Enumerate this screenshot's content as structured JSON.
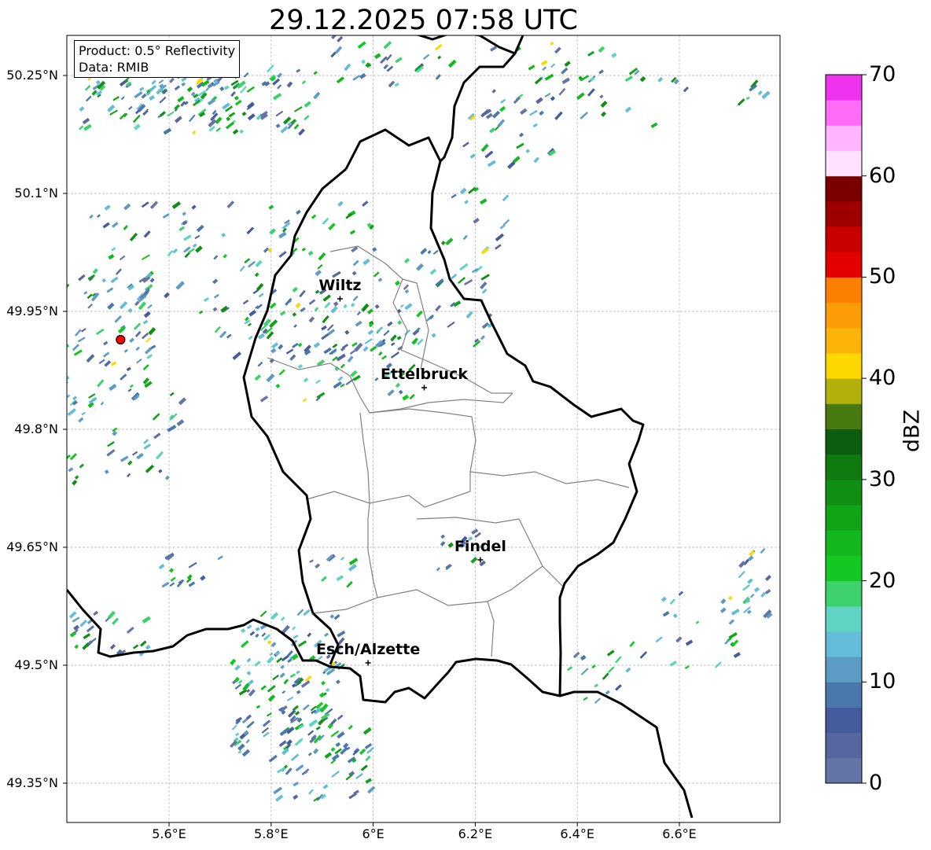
{
  "title": "29.12.2025 07:58 UTC",
  "info": {
    "product": "Product: 0.5° Reflectivity",
    "source": "Data: RMIB"
  },
  "axes": {
    "lon_ticks": [
      "5.6°E",
      "5.8°E",
      "6°E",
      "6.2°E",
      "6.4°E",
      "6.6°E"
    ],
    "lat_ticks": [
      "50.25°N",
      "50.1°N",
      "49.95°N",
      "49.8°N",
      "49.65°N",
      "49.5°N",
      "49.35°N"
    ],
    "lon_values": [
      5.6,
      5.8,
      6.0,
      6.2,
      6.4,
      6.6
    ],
    "lat_values": [
      50.25,
      50.1,
      49.95,
      49.8,
      49.65,
      49.5,
      49.35
    ],
    "lon_range": [
      5.4,
      6.8
    ],
    "lat_range": [
      49.3,
      50.3
    ]
  },
  "colorbar": {
    "label": "dBZ",
    "ticks": [
      "0",
      "10",
      "20",
      "30",
      "40",
      "50",
      "60",
      "70"
    ],
    "colors": [
      "#6574a6",
      "#55679e",
      "#445c9d",
      "#4a77ac",
      "#5c9bc4",
      "#64bcd8",
      "#5fd4c3",
      "#3dd16b",
      "#14c823",
      "#12b81e",
      "#11a416",
      "#0f8f13",
      "#0f7a10",
      "#0b5e0d",
      "#477a10",
      "#b0b10b",
      "#ffd700",
      "#fdb40a",
      "#fc9d05",
      "#fc7f00",
      "#e40000",
      "#c80000",
      "#9e0000",
      "#7a0000",
      "#ffe0ff",
      "#ffb6ff",
      "#ff6cf8",
      "#ee33ee"
    ]
  },
  "cities": [
    {
      "name": "Wiltz",
      "lon": 5.935,
      "lat": 49.966
    },
    {
      "name": "Ettelbruck",
      "lon": 6.1,
      "lat": 49.853
    },
    {
      "name": "Findel",
      "lon": 6.21,
      "lat": 49.634
    },
    {
      "name": "Esch/Alzette",
      "lon": 5.99,
      "lat": 49.503
    }
  ],
  "radar_site": {
    "lon": 5.505,
    "lat": 49.914
  }
}
